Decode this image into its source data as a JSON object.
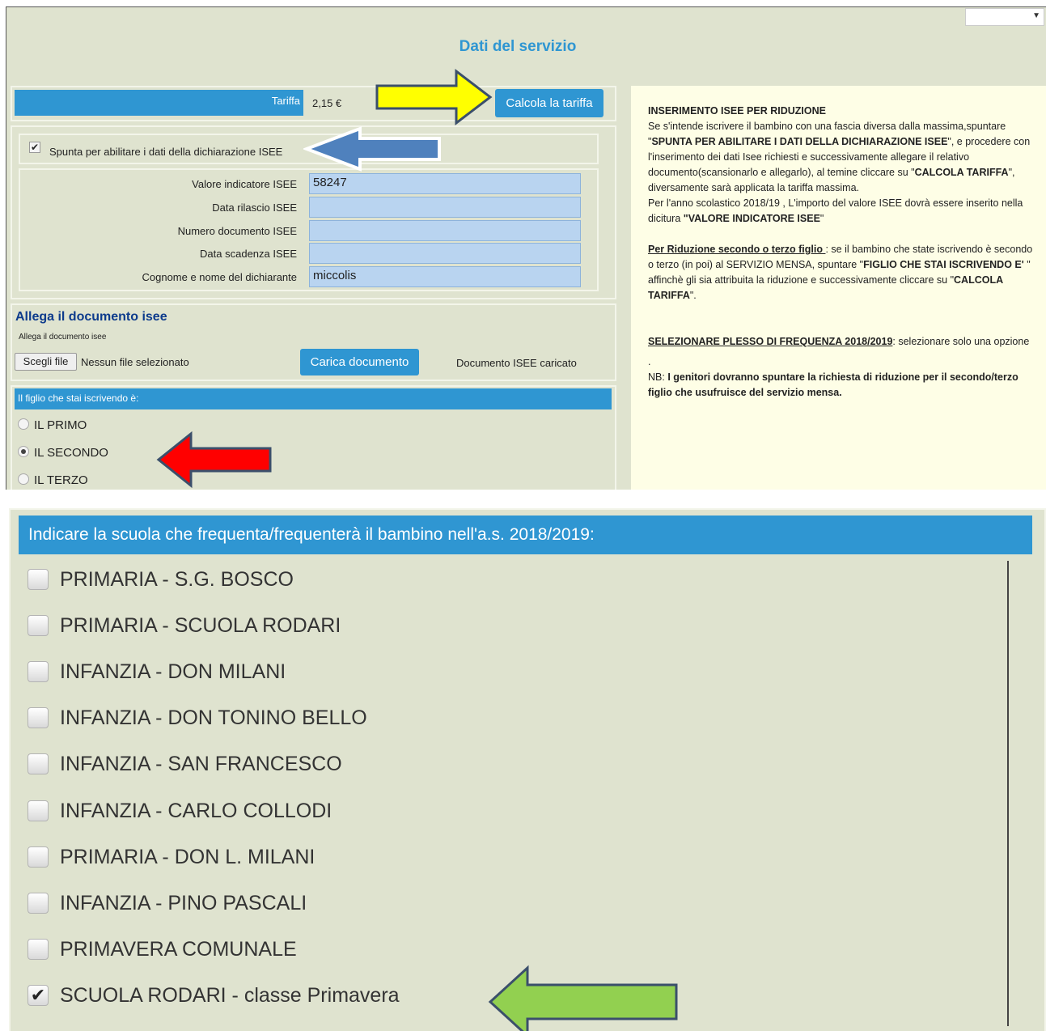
{
  "header": {
    "title": "Dati del servizio",
    "corner_select_value": ""
  },
  "tariff": {
    "label": "Tariffa",
    "value": "2,15 €",
    "button": "Calcola la tariffa"
  },
  "isee": {
    "checkbox_label": "Spunta per abilitare i dati della dichiarazione ISEE",
    "checked": true,
    "fields": [
      {
        "label": "Valore indicatore ISEE",
        "value": "58247"
      },
      {
        "label": "Data rilascio ISEE",
        "value": ""
      },
      {
        "label": "Numero documento ISEE",
        "value": ""
      },
      {
        "label": "Data scadenza ISEE",
        "value": ""
      },
      {
        "label": "Cognome e nome del dichiarante",
        "value": "miccolis"
      }
    ]
  },
  "attach": {
    "title": "Allega il documento isee",
    "subtitle": "Allega il documento isee",
    "choose_button": "Scegli file",
    "no_file": "Nessun file selezionato",
    "upload_button": "Carica documento",
    "status": "Documento ISEE caricato"
  },
  "child": {
    "header": "Il figlio che stai iscrivendo è:",
    "options": [
      "IL PRIMO",
      "IL SECONDO",
      "IL TERZO"
    ],
    "selected": "IL SECONDO"
  },
  "info": {
    "heading": "INSERIMENTO ISEE PER RIDUZIONE",
    "p1_a": "Se s'intende iscrivere il bambino con una fascia diversa dalla massima,spuntare \"",
    "p1_b": "SPUNTA PER ABILITARE I DATI DELLA DICHIARAZIONE ISEE",
    "p1_c": "\", e procedere con l'inserimento dei dati Isee richiesti e successivamente allegare il relativo documento(scansionarlo e allegarlo), al temine cliccare su \"",
    "p1_d": "CALCOLA TARIFFA",
    "p1_e": "\", diversamente sarà applicata la tariffa massima.",
    "p2_a": "Per l'anno scolastico 2018/19 , L'importo del valore ISEE dovrà essere inserito nella dicitura ",
    "p2_b": "\"VALORE INDICATORE ISEE",
    "p2_c": "\"",
    "p3_a": "Per Riduzione secondo o terzo figlio ",
    "p3_b": ": se il bambino che state iscrivendo è secondo o terzo (in poi) al SERVIZIO MENSA, spuntare \"",
    "p3_c": "FIGLIO CHE STAI ISCRIVENDO E' ",
    "p3_d": " \" affinchè gli sia attribuita la riduzione e successivamente cliccare su \"",
    "p3_e": "CALCOLA TARIFFA",
    "p3_f": "\".",
    "p4_a": "SELEZIONARE PLESSO DI FREQUENZA 2018/2019",
    "p4_b": ": selezionare solo una opzione",
    "p5": ".",
    "p6_a": "NB: ",
    "p6_b": "I genitori dovranno spuntare la richiesta di riduzione per il secondo/terzo figlio che usufruisce del servizio mensa."
  },
  "schools": {
    "header": "Indicare la scuola che frequenta/frequenterà il bambino nell'a.s. 2018/2019:",
    "items": [
      {
        "prefix": "PRIMARIA",
        "name": "S.G. BOSCO",
        "checked": false
      },
      {
        "prefix": "PRIMARIA",
        "name": "SCUOLA RODARI",
        "checked": false
      },
      {
        "prefix": "INFANZIA",
        "name": "DON MILANI",
        "checked": false
      },
      {
        "prefix": "INFANZIA",
        "name": "DON TONINO BELLO",
        "checked": false
      },
      {
        "prefix": "INFANZIA",
        "name": "SAN FRANCESCO",
        "checked": false
      },
      {
        "prefix": "INFANZIA",
        "name": "CARLO COLLODI",
        "checked": false
      },
      {
        "prefix": "PRIMARIA",
        "name": "DON L. MILANI",
        "checked": false
      },
      {
        "prefix": "INFANZIA",
        "name": "PINO PASCALI",
        "checked": false
      },
      {
        "prefix": "PRIMAVERA COMUNALE",
        "name": "",
        "checked": false
      },
      {
        "prefix": "SCUOLA RODARI",
        "name": "classe Primavera",
        "checked": true
      }
    ]
  },
  "colors": {
    "panel": "#dfe3cf",
    "accent_blue": "#2f96d2",
    "info_bg": "#fefee6",
    "arrow_yellow": "#ffff00",
    "arrow_blue": "#4f81bd",
    "arrow_red": "#ff0000",
    "arrow_green": "#92d050"
  }
}
